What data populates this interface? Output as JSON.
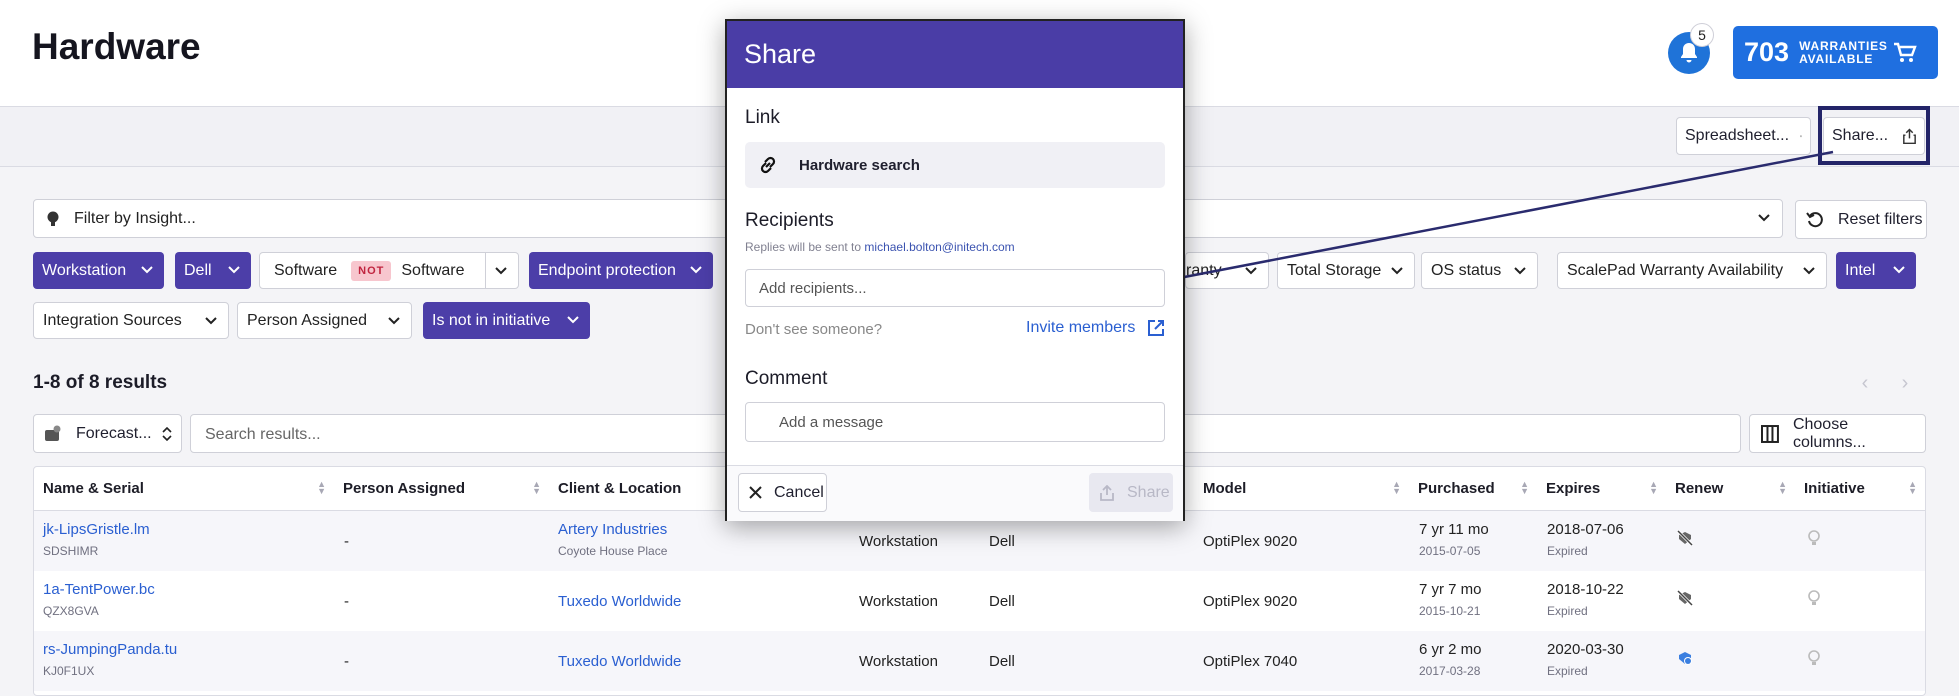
{
  "header": {
    "title": "Hardware",
    "notification_count": "5",
    "warranties_count": "703",
    "warranties_label": "WARRANTIES AVAILABLE"
  },
  "toolbar": {
    "spreadsheet_label": "Spreadsheet...",
    "share_label": "Share..."
  },
  "filter": {
    "placeholder": "Filter by Insight...",
    "reset_label": "Reset filters"
  },
  "chips": {
    "workstation": "Workstation",
    "dell": "Dell",
    "software": "Software",
    "not": "NOT",
    "software2": "Software",
    "endpoint": "Endpoint protection",
    "warranty_tail": "ranty",
    "total_storage": "Total Storage",
    "os_status": "OS status",
    "scalepad": "ScalePad Warranty Availability",
    "intel": "Intel",
    "integration": "Integration Sources",
    "person": "Person Assigned",
    "initiative": "Is not in initiative"
  },
  "results": {
    "count_label": "1-8 of 8 results",
    "forecast_label": "Forecast...",
    "search_placeholder": "Search results...",
    "choose_columns": "Choose columns..."
  },
  "table": {
    "headers": {
      "name": "Name & Serial",
      "person": "Person Assigned",
      "client": "Client & Location",
      "model": "Model",
      "purchased": "Purchased",
      "expires": "Expires",
      "renew": "Renew",
      "initiative": "Initiative"
    },
    "rows": [
      {
        "name": "jk-LipsGristle.lm",
        "serial": "SDSHIMR",
        "person": "-",
        "client": "Artery Industries",
        "location": "Coyote House Place",
        "type": "Workstation",
        "make": "Dell",
        "model": "OptiPlex 9020",
        "age": "7 yr 11 mo",
        "purchased": "2015-07-05",
        "expires": "2018-07-06",
        "status": "Expired"
      },
      {
        "name": "1a-TentPower.bc",
        "serial": "QZX8GVA",
        "person": "-",
        "client": "Tuxedo Worldwide",
        "location": "",
        "type": "Workstation",
        "make": "Dell",
        "model": "OptiPlex 9020",
        "age": "7 yr 7 mo",
        "purchased": "2015-10-21",
        "expires": "2018-10-22",
        "status": "Expired"
      },
      {
        "name": "rs-JumpingPanda.tu",
        "serial": "KJ0F1UX",
        "person": "-",
        "client": "Tuxedo Worldwide",
        "location": "",
        "type": "Workstation",
        "make": "Dell",
        "model": "OptiPlex 7040",
        "age": "6 yr 2 mo",
        "purchased": "2017-03-28",
        "expires": "2020-03-30",
        "status": "Expired"
      }
    ]
  },
  "modal": {
    "title": "Share",
    "link_heading": "Link",
    "link_text": "Hardware search",
    "recipients_heading": "Recipients",
    "replies_note": "Replies will be sent to",
    "reply_email": "michael.bolton@initech.com",
    "recipients_placeholder": "Add recipients...",
    "dont_see": "Don't see someone?",
    "invite_label": "Invite members",
    "comment_heading": "Comment",
    "message_placeholder": "Add a message",
    "cancel_label": "Cancel",
    "share_label": "Share"
  },
  "colors": {
    "primary": "#4a3da6",
    "accent_blue": "#1f6fe0",
    "link": "#2a5fd1"
  }
}
